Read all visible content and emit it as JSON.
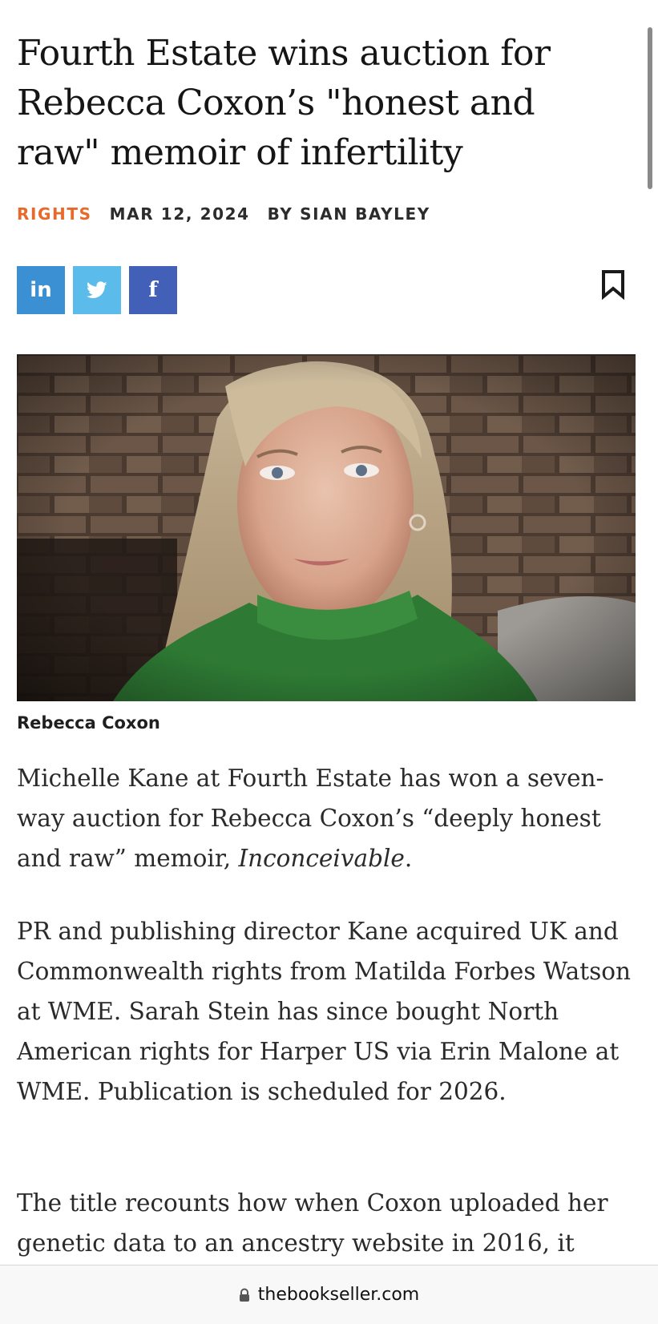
{
  "article": {
    "title": "Fourth Estate wins auction for Rebecca Coxon’s \"honest and raw\" memoir of infertility",
    "category": "RIGHTS",
    "date": "MAR 12, 2024",
    "byline": "BY SIAN BAYLEY"
  },
  "share": {
    "linkedin_label": "in",
    "twitter_icon": "twitter-bird-icon",
    "facebook_label": "f"
  },
  "image": {
    "caption": "Rebecca Coxon"
  },
  "body": {
    "p1_start": "Michelle Kane at Fourth Estate has won a seven-way auction for Rebecca Coxon’s “deeply honest and raw” memoir, ",
    "p1_title": "Inconceivable",
    "p1_end": ".",
    "p2": "PR and publishing director Kane acquired UK and Commonwealth rights from Matilda Forbes Watson at WME. Sarah Stein has since bought North American rights for Harper US via Erin Malone at WME. Publication is scheduled for 2026.",
    "p3": "The title recounts how when Coxon uploaded her genetic data to an ancestry website in 2016, it"
  },
  "browser": {
    "url": "thebookseller.com"
  },
  "colors": {
    "category": "#e8692a",
    "linkedin": "#3b8fd3",
    "twitter": "#5bbcec",
    "facebook": "#4260b8"
  }
}
